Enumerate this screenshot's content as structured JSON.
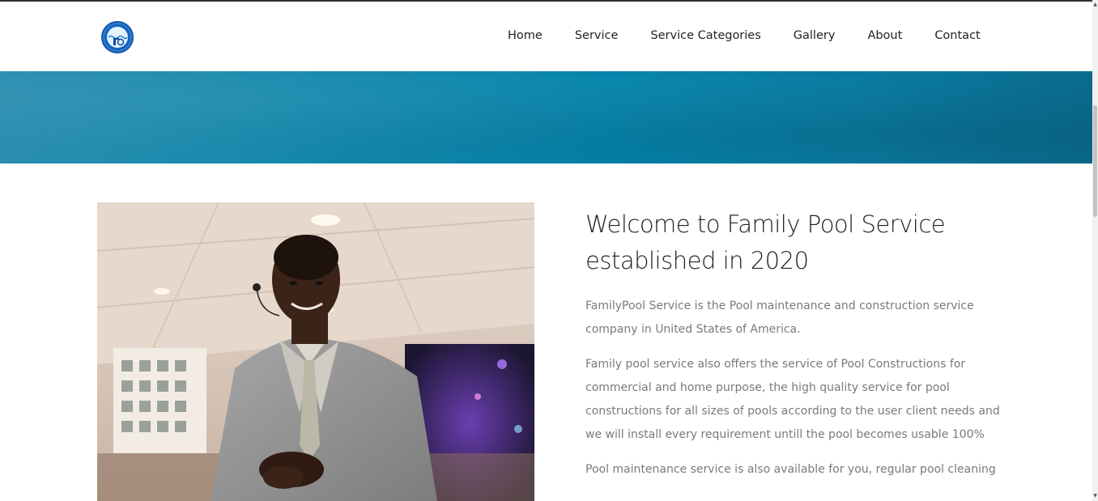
{
  "header": {
    "logo_alt": "FPS",
    "nav": [
      {
        "label": "Home"
      },
      {
        "label": "Service"
      },
      {
        "label": "Service Categories"
      },
      {
        "label": "Gallery"
      },
      {
        "label": "About"
      },
      {
        "label": "Contact"
      }
    ]
  },
  "banner": {
    "color": "#0483ab"
  },
  "intro": {
    "heading": "Welcome to Family Pool Service established in 2020",
    "paragraphs": [
      "FamilyPool Service is the Pool maintenance and construction service company in United States of America.",
      "Family pool service also offers the service of Pool Constructions for commercial and home purpose, the high quality service for pool constructions for all sizes of pools according to the user client needs and we will install every requirement untill the pool becomes usable 100%",
      "Pool maintenance service is also available for you, regular pool cleaning"
    ]
  },
  "colors": {
    "nav_text": "#222222",
    "body_text": "#7a7a7a",
    "heading_text": "#222222",
    "banner": "#0483ab"
  }
}
